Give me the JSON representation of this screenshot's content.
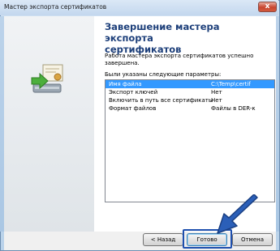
{
  "window": {
    "title": "Мастер экспорта сертификатов",
    "close_glyph": "x"
  },
  "page": {
    "heading_line1": "Завершение мастера экспорта",
    "heading_line2": "сертификатов",
    "description_line1": "Работа мастера экспорта сертификатов успешно",
    "description_line2": "завершена.",
    "params_label": "Были указаны следующие параметры:"
  },
  "params": [
    {
      "name": "Имя файла",
      "value": "C:\\Temp\\certif",
      "selected": true
    },
    {
      "name": "Экспорт ключей",
      "value": "Нет",
      "selected": false
    },
    {
      "name": "Включить в путь все сертификаты",
      "value": "Нет",
      "selected": false
    },
    {
      "name": "Формат файлов",
      "value": "Файлы в DER-к",
      "selected": false
    }
  ],
  "buttons": {
    "back": "< Назад",
    "finish": "Готово",
    "cancel": "Отмена"
  },
  "colors": {
    "heading": "#1d3f7a",
    "selection": "#3399ff",
    "arrow": "#2b5fb8"
  }
}
